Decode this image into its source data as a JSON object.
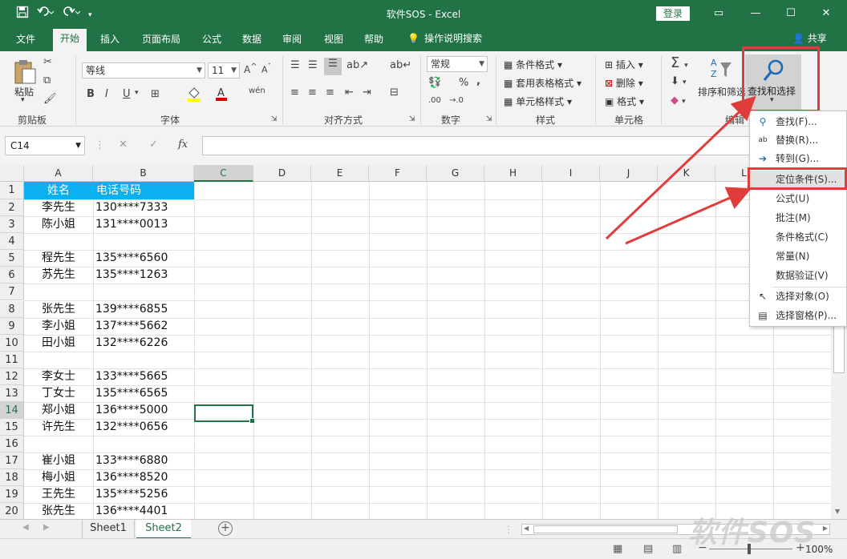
{
  "window": {
    "title": "软件SOS  -  Excel",
    "login": "登录",
    "minimize": "—",
    "restore": "☐",
    "close": "✕",
    "ribbon_options": "▭"
  },
  "tabs": [
    "文件",
    "开始",
    "插入",
    "页面布局",
    "公式",
    "数据",
    "审阅",
    "视图",
    "帮助"
  ],
  "tellme": "操作说明搜索",
  "share": "共享",
  "ribbon": {
    "clipboard": {
      "paste": "粘贴",
      "label": "剪贴板"
    },
    "font": {
      "name": "等线",
      "size": "11",
      "bold": "B",
      "italic": "I",
      "underline": "U",
      "label": "字体"
    },
    "alignment": {
      "label": "对齐方式"
    },
    "number": {
      "format": "常规",
      "percent": "%",
      "comma": ",",
      "label": "数字",
      "inc": ".00",
      "dec": "→.0"
    },
    "styles": {
      "cond": "条件格式",
      "table": "套用表格格式",
      "cell": "单元格样式",
      "label": "样式"
    },
    "cells": {
      "insert": "插入",
      "delete": "删除",
      "format": "格式",
      "label": "单元格"
    },
    "editing": {
      "sort": "排序和筛选",
      "find": "查找和选择",
      "label": "编辑"
    }
  },
  "formula_bar": {
    "namebox": "C14",
    "fx": "fx"
  },
  "columns": [
    "A",
    "B",
    "C",
    "D",
    "E",
    "F",
    "G",
    "H",
    "I",
    "J",
    "K",
    "L"
  ],
  "rows": [
    "1",
    "2",
    "3",
    "4",
    "5",
    "6",
    "7",
    "8",
    "9",
    "10",
    "11",
    "12",
    "13",
    "14",
    "15",
    "16",
    "17",
    "18",
    "19",
    "20"
  ],
  "cells": {
    "header": [
      "姓名",
      "电话号码"
    ],
    "data": [
      [
        "李先生",
        "130****7333"
      ],
      [
        "陈小姐",
        "131****0013"
      ],
      [
        "",
        ""
      ],
      [
        "程先生",
        "135****6560"
      ],
      [
        "苏先生",
        "135****1263"
      ],
      [
        "",
        ""
      ],
      [
        "张先生",
        "139****6855"
      ],
      [
        "李小姐",
        "137****5662"
      ],
      [
        "田小姐",
        "132****6226"
      ],
      [
        "",
        ""
      ],
      [
        "李女士",
        "133****5665"
      ],
      [
        "丁女士",
        "135****6565"
      ],
      [
        "郑小姐",
        "136****5000"
      ],
      [
        "许先生",
        "132****0656"
      ],
      [
        "",
        ""
      ],
      [
        "崔小姐",
        "133****6880"
      ],
      [
        "梅小姐",
        "136****8520"
      ],
      [
        "王先生",
        "135****5256"
      ],
      [
        "张先生",
        "136****4401"
      ]
    ]
  },
  "sheets": [
    "Sheet1",
    "Sheet2"
  ],
  "status": {
    "zoom": "100%",
    "zoom_minus": "−",
    "zoom_plus": "+"
  },
  "menu": [
    {
      "label": "查找(F)...",
      "icon": "search-icon",
      "glyph": "🔍"
    },
    {
      "label": "替换(R)...",
      "icon": "replace-icon",
      "glyph": "ab"
    },
    {
      "label": "转到(G)...",
      "icon": "goto-arrow-icon",
      "glyph": "➔"
    },
    {
      "label": "定位条件(S)...",
      "icon": "",
      "glyph": ""
    },
    {
      "label": "公式(U)",
      "icon": "",
      "glyph": ""
    },
    {
      "label": "批注(M)",
      "icon": "",
      "glyph": ""
    },
    {
      "label": "条件格式(C)",
      "icon": "",
      "glyph": ""
    },
    {
      "label": "常量(N)",
      "icon": "",
      "glyph": ""
    },
    {
      "label": "数据验证(V)",
      "icon": "",
      "glyph": ""
    },
    {
      "label": "选择对象(O)",
      "icon": "pointer-icon",
      "glyph": "↖"
    },
    {
      "label": "选择窗格(P)...",
      "icon": "selection-pane-icon",
      "glyph": "▤"
    }
  ],
  "watermark": "软件SOS",
  "colors": {
    "excel_green": "#217346",
    "header_fill": "#0ab0ef",
    "annotation_red": "#e03c3c"
  }
}
